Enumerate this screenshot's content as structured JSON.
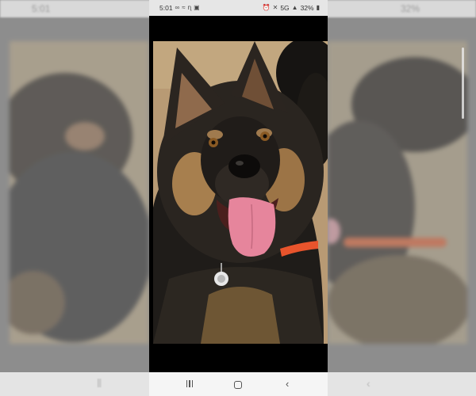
{
  "status_bar": {
    "time": "5:01",
    "left_icons": [
      "voicemail-icon",
      "cast-icon",
      "notification-icon",
      "message-icon"
    ],
    "network": "5G",
    "battery": "32%",
    "right_icons": [
      "alarm-icon",
      "mute-icon",
      "signal-icon",
      "battery-icon"
    ]
  },
  "photo": {
    "subject_icon": "dog-photo"
  },
  "nav_bar": {
    "recents_icon": "recents-icon",
    "home_icon": "home-icon",
    "back_icon": "back-icon",
    "back_glyph": "‹"
  },
  "colors": {
    "page_background": "#8e8e8e",
    "status_bar": "#e6e6e6",
    "nav_bar": "#f5f5f5",
    "collar": "#e8542c"
  }
}
